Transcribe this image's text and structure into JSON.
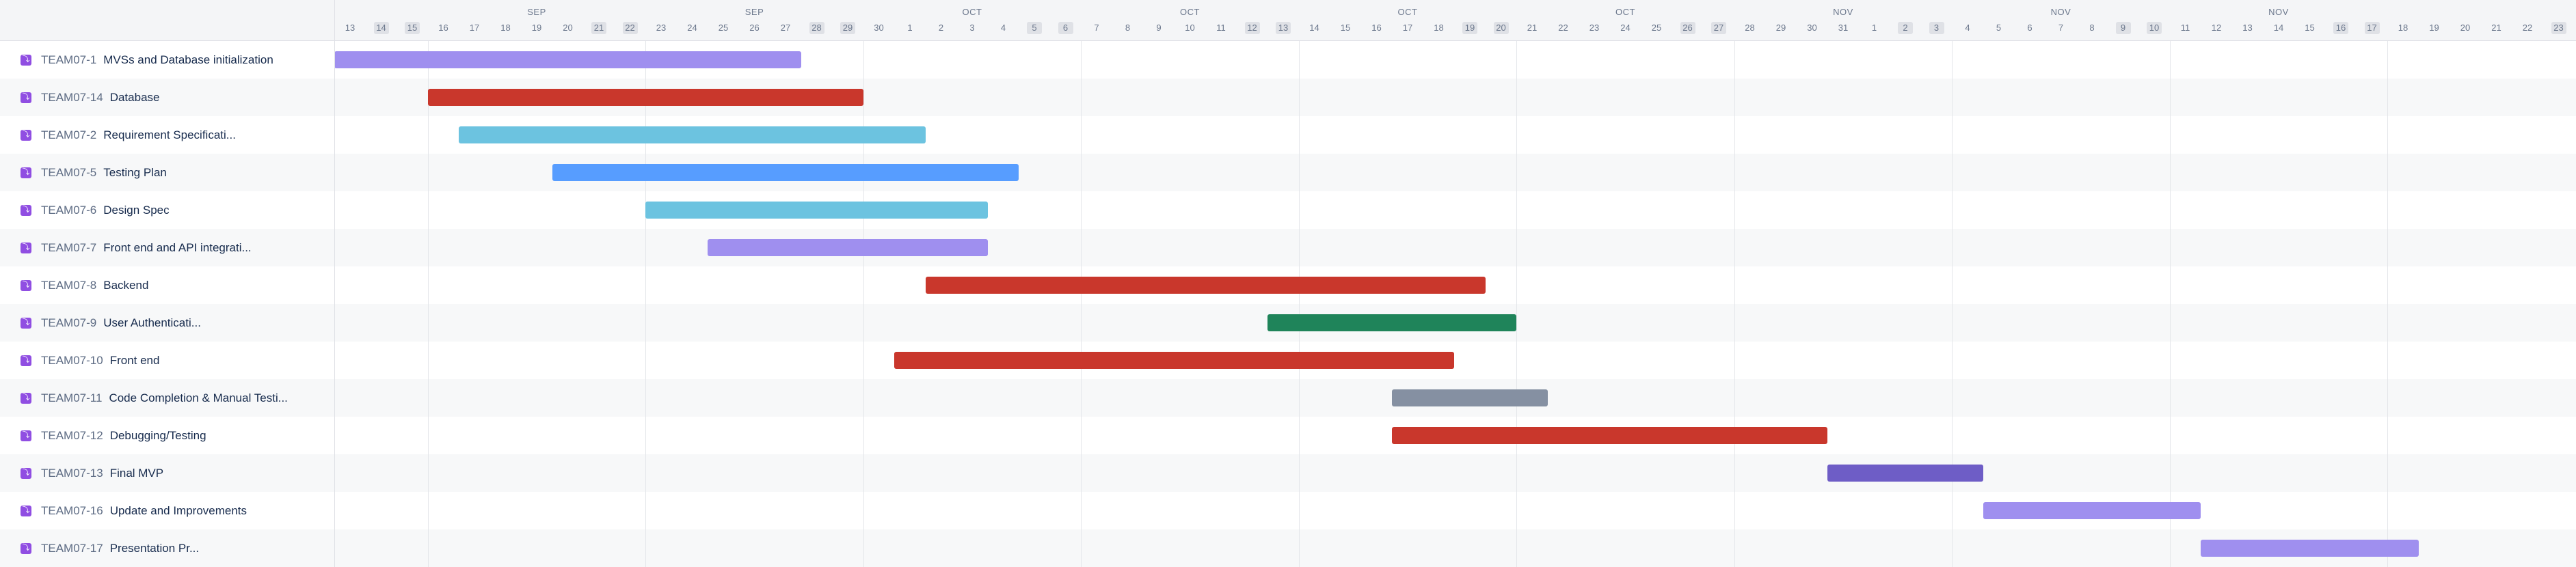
{
  "timeline": {
    "months": [
      "SEP",
      "SEP",
      "OCT",
      "OCT",
      "OCT",
      "OCT",
      "NOV",
      "NOV",
      "NOV"
    ],
    "days": [
      {
        "label": "13",
        "weekend": false
      },
      {
        "label": "14",
        "weekend": true
      },
      {
        "label": "15",
        "weekend": true
      },
      {
        "label": "16",
        "weekend": false
      },
      {
        "label": "17",
        "weekend": false
      },
      {
        "label": "18",
        "weekend": false
      },
      {
        "label": "19",
        "weekend": false
      },
      {
        "label": "20",
        "weekend": false
      },
      {
        "label": "21",
        "weekend": true
      },
      {
        "label": "22",
        "weekend": true
      },
      {
        "label": "23",
        "weekend": false
      },
      {
        "label": "24",
        "weekend": false
      },
      {
        "label": "25",
        "weekend": false
      },
      {
        "label": "26",
        "weekend": false
      },
      {
        "label": "27",
        "weekend": false
      },
      {
        "label": "28",
        "weekend": true
      },
      {
        "label": "29",
        "weekend": true
      },
      {
        "label": "30",
        "weekend": false
      },
      {
        "label": "1",
        "weekend": false
      },
      {
        "label": "2",
        "weekend": false
      },
      {
        "label": "3",
        "weekend": false
      },
      {
        "label": "4",
        "weekend": false
      },
      {
        "label": "5",
        "weekend": true
      },
      {
        "label": "6",
        "weekend": true
      },
      {
        "label": "7",
        "weekend": false
      },
      {
        "label": "8",
        "weekend": false
      },
      {
        "label": "9",
        "weekend": false
      },
      {
        "label": "10",
        "weekend": false
      },
      {
        "label": "11",
        "weekend": false
      },
      {
        "label": "12",
        "weekend": true
      },
      {
        "label": "13",
        "weekend": true
      },
      {
        "label": "14",
        "weekend": false
      },
      {
        "label": "15",
        "weekend": false
      },
      {
        "label": "16",
        "weekend": false
      },
      {
        "label": "17",
        "weekend": false
      },
      {
        "label": "18",
        "weekend": false
      },
      {
        "label": "19",
        "weekend": true
      },
      {
        "label": "20",
        "weekend": true
      },
      {
        "label": "21",
        "weekend": false
      },
      {
        "label": "22",
        "weekend": false
      },
      {
        "label": "23",
        "weekend": false
      },
      {
        "label": "24",
        "weekend": false
      },
      {
        "label": "25",
        "weekend": false
      },
      {
        "label": "26",
        "weekend": true
      },
      {
        "label": "27",
        "weekend": true
      },
      {
        "label": "28",
        "weekend": false
      },
      {
        "label": "29",
        "weekend": false
      },
      {
        "label": "30",
        "weekend": false
      },
      {
        "label": "31",
        "weekend": false
      },
      {
        "label": "1",
        "weekend": false
      },
      {
        "label": "2",
        "weekend": true
      },
      {
        "label": "3",
        "weekend": true
      },
      {
        "label": "4",
        "weekend": false
      },
      {
        "label": "5",
        "weekend": false
      },
      {
        "label": "6",
        "weekend": false
      },
      {
        "label": "7",
        "weekend": false
      },
      {
        "label": "8",
        "weekend": false
      },
      {
        "label": "9",
        "weekend": true
      },
      {
        "label": "10",
        "weekend": true
      },
      {
        "label": "11",
        "weekend": false
      },
      {
        "label": "12",
        "weekend": false
      },
      {
        "label": "13",
        "weekend": false
      },
      {
        "label": "14",
        "weekend": false
      },
      {
        "label": "15",
        "weekend": false
      },
      {
        "label": "16",
        "weekend": true
      },
      {
        "label": "17",
        "weekend": true
      },
      {
        "label": "18",
        "weekend": false
      },
      {
        "label": "19",
        "weekend": false
      },
      {
        "label": "20",
        "weekend": false
      },
      {
        "label": "21",
        "weekend": false
      },
      {
        "label": "22",
        "weekend": false
      },
      {
        "label": "23",
        "weekend": true
      }
    ]
  },
  "tasks": [
    {
      "key": "TEAM07-1",
      "name": "MVSs and Database initialization",
      "start": "2024-09-13",
      "end": "2024-09-28",
      "color": "#9f8fef",
      "icon": "subtask-icon"
    },
    {
      "key": "TEAM07-14",
      "name": "Database",
      "start": "2024-09-16",
      "end": "2024-09-30",
      "color": "#c9372c",
      "icon": "subtask-icon"
    },
    {
      "key": "TEAM07-2",
      "name": "Requirement Specificati...",
      "start": "2024-09-17",
      "end": "2024-10-02",
      "color": "#6cc3e0",
      "icon": "subtask-icon"
    },
    {
      "key": "TEAM07-5",
      "name": "Testing Plan",
      "start": "2024-09-20",
      "end": "2024-10-05",
      "color": "#579dff",
      "icon": "subtask-icon"
    },
    {
      "key": "TEAM07-6",
      "name": "Design Spec",
      "start": "2024-09-23",
      "end": "2024-10-04",
      "color": "#6cc3e0",
      "icon": "subtask-icon"
    },
    {
      "key": "TEAM07-7",
      "name": "Front end and API integrati...",
      "start": "2024-09-25",
      "end": "2024-10-04",
      "color": "#9f8fef",
      "icon": "subtask-icon"
    },
    {
      "key": "TEAM07-8",
      "name": "Backend",
      "start": "2024-10-02",
      "end": "2024-10-20",
      "color": "#c9372c",
      "icon": "subtask-icon"
    },
    {
      "key": "TEAM07-9",
      "name": "User Authenticati...",
      "start": "2024-10-13",
      "end": "2024-10-21",
      "color": "#1f845a",
      "icon": "subtask-icon"
    },
    {
      "key": "TEAM07-10",
      "name": "Front end",
      "start": "2024-10-01",
      "end": "2024-10-19",
      "color": "#c9372c",
      "icon": "subtask-icon"
    },
    {
      "key": "TEAM07-11",
      "name": "Code Completion & Manual Testi...",
      "start": "2024-10-17",
      "end": "2024-10-22",
      "color": "#8590a2",
      "icon": "subtask-icon"
    },
    {
      "key": "TEAM07-12",
      "name": "Debugging/Testing",
      "start": "2024-10-17",
      "end": "2024-10-31",
      "color": "#c9372c",
      "icon": "subtask-icon"
    },
    {
      "key": "TEAM07-13",
      "name": "Final MVP",
      "start": "2024-10-31",
      "end": "2024-11-05",
      "color": "#6e5dc6",
      "icon": "subtask-icon"
    },
    {
      "key": "TEAM07-16",
      "name": "Update and Improvements",
      "start": "2024-11-05",
      "end": "2024-11-12",
      "color": "#9f8fef",
      "icon": "subtask-icon"
    },
    {
      "key": "TEAM07-17",
      "name": "Presentation Pr...",
      "start": "2024-11-12",
      "end": "2024-11-19",
      "color": "#9f8fef",
      "icon": "subtask-icon"
    }
  ]
}
